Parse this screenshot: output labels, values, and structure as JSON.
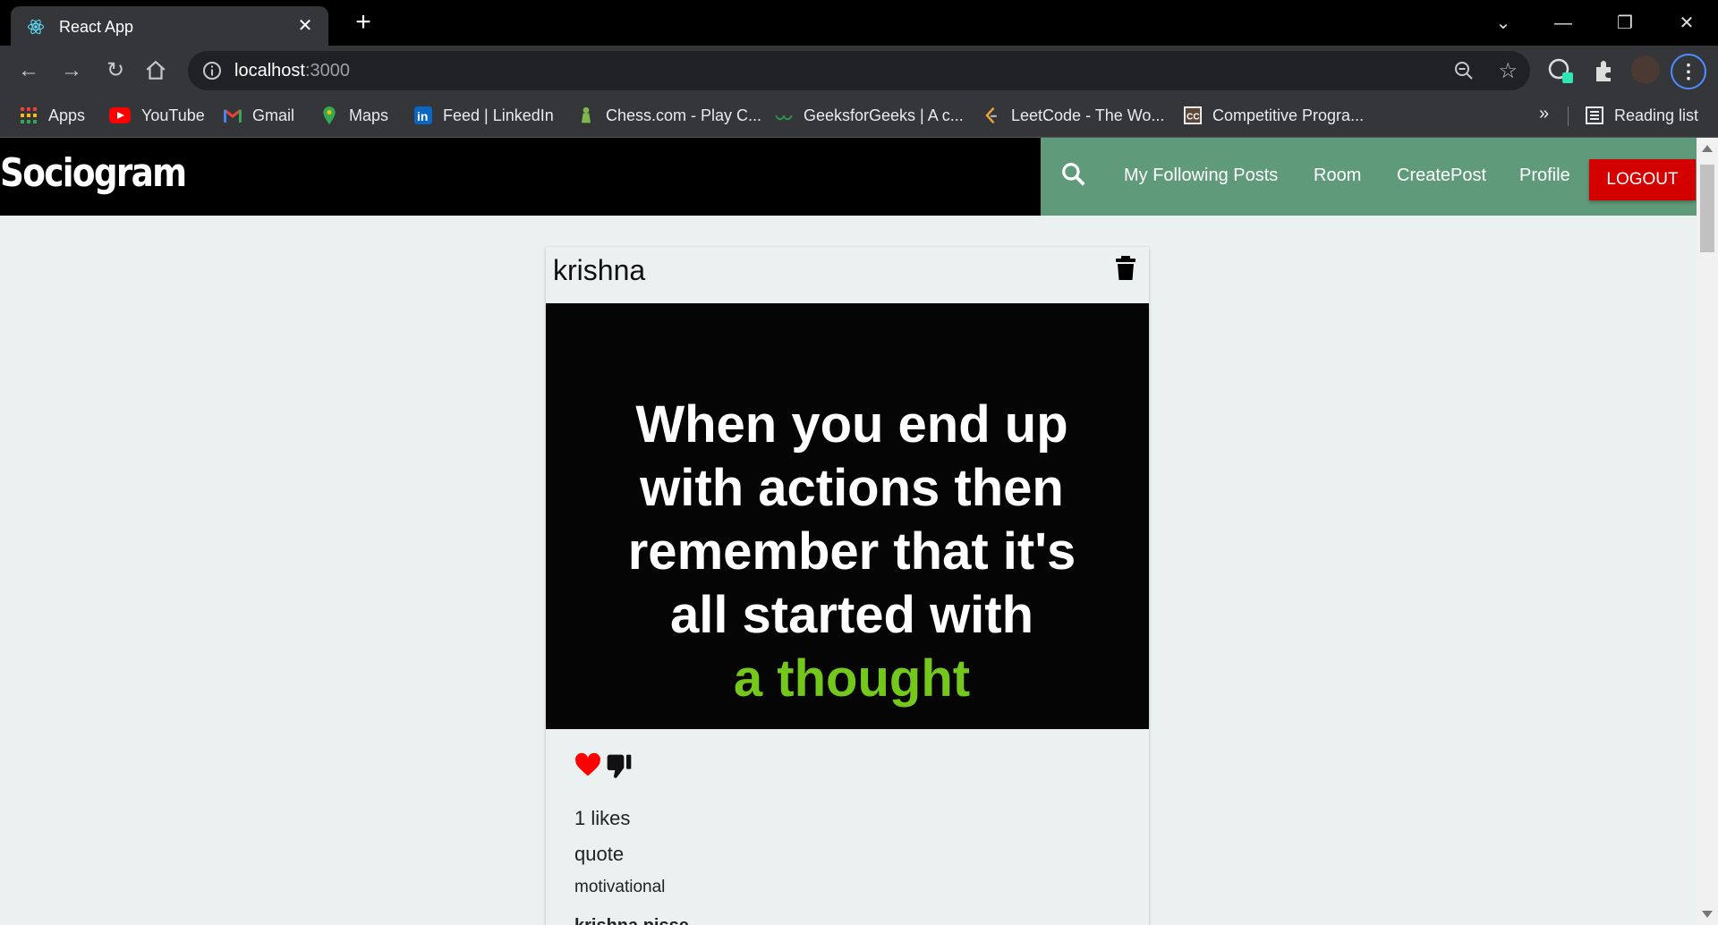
{
  "browser": {
    "tab_title": "React App",
    "url_host": "localhost",
    "url_port": ":3000",
    "bookmarks": [
      {
        "label": "Apps",
        "icon": "apps-grid-icon"
      },
      {
        "label": "YouTube",
        "icon": "youtube-icon"
      },
      {
        "label": "Gmail",
        "icon": "gmail-icon"
      },
      {
        "label": "Maps",
        "icon": "maps-icon"
      },
      {
        "label": "Feed | LinkedIn",
        "icon": "linkedin-icon"
      },
      {
        "label": "Chess.com - Play C...",
        "icon": "chess-icon"
      },
      {
        "label": "GeeksforGeeks | A c...",
        "icon": "geeksforgeeks-icon"
      },
      {
        "label": "LeetCode - The Wo...",
        "icon": "leetcode-icon"
      },
      {
        "label": "Competitive Progra...",
        "icon": "codechef-icon"
      }
    ],
    "more_bookmarks": "»",
    "reading_list": "Reading list"
  },
  "app": {
    "brand": "Sociogram",
    "nav": {
      "following": "My Following Posts",
      "room": "Room",
      "create": "CreatePost",
      "profile": "Profile",
      "logout": "LOGOUT"
    },
    "colors": {
      "navbar": "#000000",
      "nav_accent": "#5f9b7a",
      "logout": "#d40000",
      "quote_accent": "#74c81b"
    }
  },
  "post": {
    "author": "krishna",
    "image_text": {
      "lines": [
        "When you end up",
        "with actions then",
        "remember that it's",
        "all started with"
      ],
      "accent": "a thought"
    },
    "likes": "1 likes",
    "title": "quote",
    "body": "motivational",
    "comment_author": "krishna pisse"
  }
}
